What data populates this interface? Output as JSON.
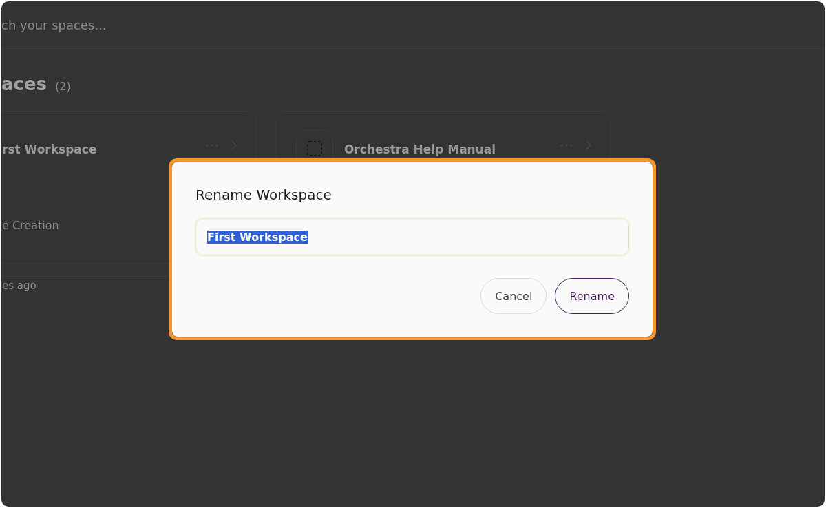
{
  "search": {
    "placeholder": "ch your spaces..."
  },
  "section": {
    "title": "aces",
    "count": "(2)"
  },
  "workspaces": [
    {
      "title": "rst Workspace",
      "subtitle": "e Creation",
      "updated": "es ago",
      "icon": false
    },
    {
      "title": "Orchestra Help Manual",
      "icon": true
    }
  ],
  "dialog": {
    "title": "Rename Workspace",
    "highlighted": true,
    "field": {
      "value": "First Workspace",
      "selected": true
    },
    "buttons": [
      {
        "label": "Cancel",
        "kind": "secondary"
      },
      {
        "label": "Rename",
        "kind": "primary"
      }
    ]
  }
}
